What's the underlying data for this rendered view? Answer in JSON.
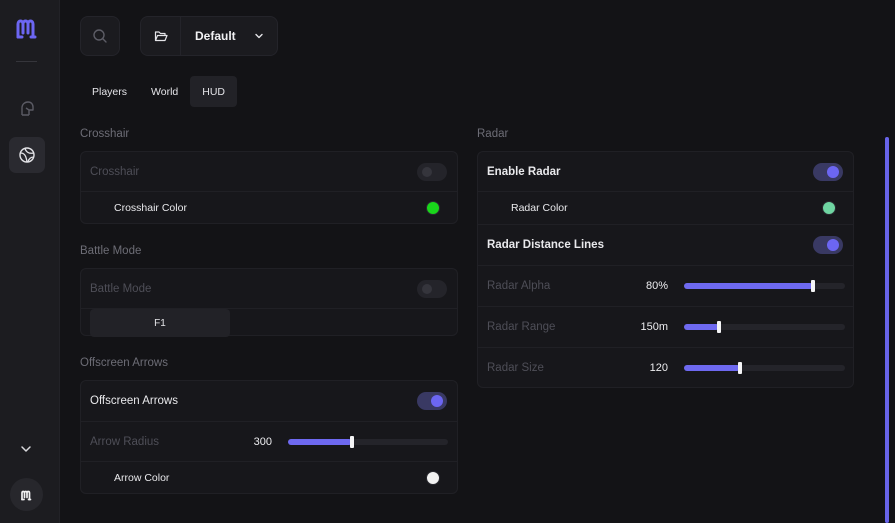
{
  "colors": {
    "accent": "#6c66f2",
    "crosshair_color": "#19d61b",
    "radar_color": "#6fd5a2",
    "arrow_color": "#f2f2f2"
  },
  "header": {
    "profile_name": "Default"
  },
  "tabs": [
    {
      "label": "Players",
      "active": false
    },
    {
      "label": "World",
      "active": false
    },
    {
      "label": "HUD",
      "active": true
    }
  ],
  "crosshair": {
    "title": "Crosshair",
    "toggle_label": "Crosshair",
    "enabled": false,
    "color_label": "Crosshair Color"
  },
  "battle_mode": {
    "title": "Battle Mode",
    "toggle_label": "Battle Mode",
    "enabled": false,
    "keybind": "F1"
  },
  "offscreen_arrows": {
    "title": "Offscreen Arrows",
    "toggle_label": "Offscreen Arrows",
    "enabled": true,
    "radius_label": "Arrow Radius",
    "radius_value": "300",
    "radius_fraction": 0.4,
    "color_label": "Arrow Color"
  },
  "radar": {
    "title": "Radar",
    "enable_label": "Enable Radar",
    "enabled": true,
    "color_label": "Radar Color",
    "distance_lines_label": "Radar Distance Lines",
    "distance_lines_enabled": true,
    "alpha_label": "Radar Alpha",
    "alpha_value": "80%",
    "alpha_fraction": 0.8,
    "range_label": "Radar Range",
    "range_value": "150m",
    "range_fraction": 0.22,
    "size_label": "Radar Size",
    "size_value": "120",
    "size_fraction": 0.35
  }
}
